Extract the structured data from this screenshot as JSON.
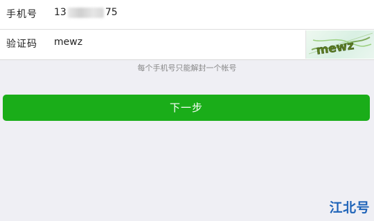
{
  "form": {
    "phone": {
      "label": "手机号",
      "value_prefix": "13",
      "value_suffix": "75"
    },
    "captcha": {
      "label": "验证码",
      "value": "mewz",
      "image_text": "mewz"
    }
  },
  "hint": "每个手机号只能解封一个帐号",
  "next_button": {
    "label": "下一步",
    "color": "#1aad19"
  },
  "watermark": "江北号",
  "colors": {
    "accent": "#1aad19",
    "background": "#efeff4",
    "watermark": "#1e63b8"
  }
}
